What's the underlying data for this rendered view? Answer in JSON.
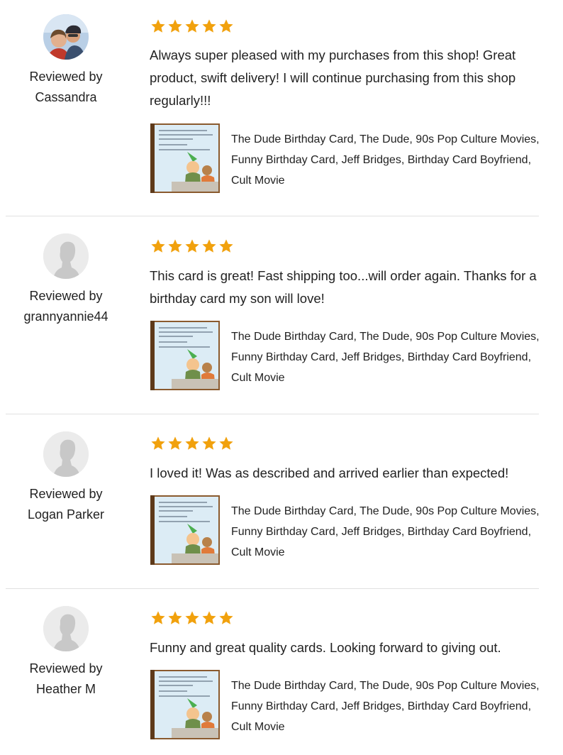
{
  "reviewed_by_label": "Reviewed by",
  "colors": {
    "star": "#f1a10d",
    "divider": "#e1e1e1",
    "text": "#222222"
  },
  "reviews": [
    {
      "reviewer": "Cassandra",
      "avatar": "user-photo",
      "rating": 5,
      "text": "Always super pleased with my purchases from this shop! Great product, swift delivery! I will continue purchasing from this shop regularly!!!",
      "listing_title": "The Dude Birthday Card, The Dude, 90s Pop Culture Movies, Funny Birthday Card, Jeff Bridges, Birthday Card Boyfriend, Cult Movie"
    },
    {
      "reviewer": "grannyannie44",
      "avatar": "default-user-silhouette",
      "rating": 5,
      "text": "This card is great! Fast shipping too...will order again. Thanks for a birthday card my son will love!",
      "listing_title": "The Dude Birthday Card, The Dude, 90s Pop Culture Movies, Funny Birthday Card, Jeff Bridges, Birthday Card Boyfriend, Cult Movie"
    },
    {
      "reviewer": "Logan Parker",
      "avatar": "default-user-silhouette",
      "rating": 5,
      "text": "I loved it! Was as described and arrived earlier than expected!",
      "listing_title": "The Dude Birthday Card, The Dude, 90s Pop Culture Movies, Funny Birthday Card, Jeff Bridges, Birthday Card Boyfriend, Cult Movie"
    },
    {
      "reviewer": "Heather M",
      "avatar": "default-user-silhouette",
      "rating": 5,
      "text": "Funny and great quality cards. Looking forward to giving out.",
      "listing_title": "The Dude Birthday Card, The Dude, 90s Pop Culture Movies, Funny Birthday Card, Jeff Bridges, Birthday Card Boyfriend, Cult Movie"
    }
  ]
}
